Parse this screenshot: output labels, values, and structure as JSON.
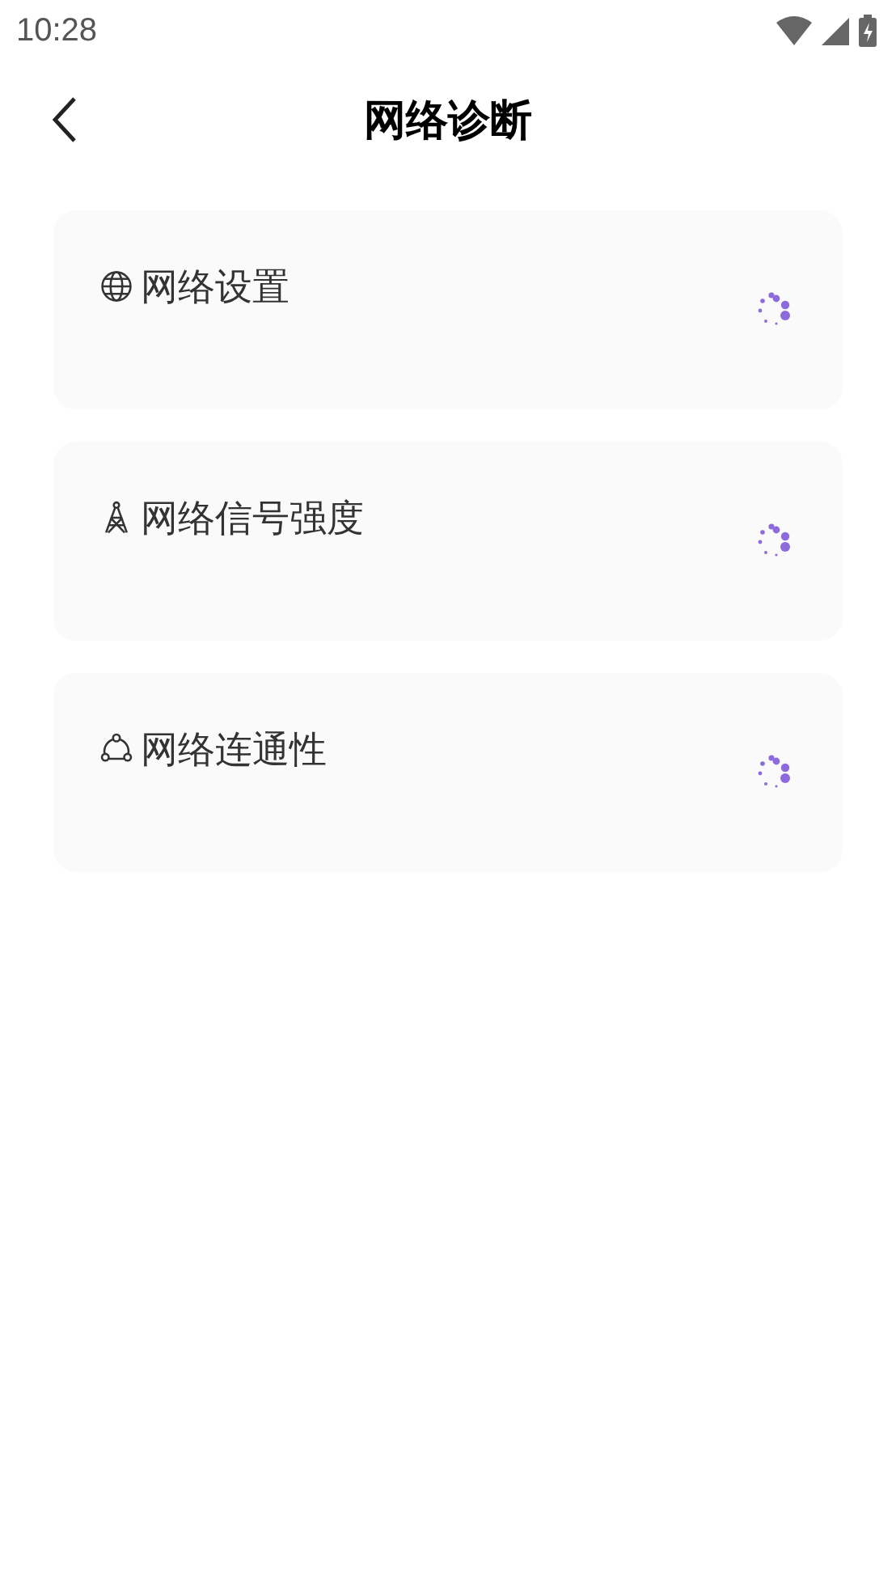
{
  "status_bar": {
    "time": "10:28"
  },
  "header": {
    "title": "网络诊断"
  },
  "items": [
    {
      "label": "网络设置",
      "kind": "globe",
      "loading": true
    },
    {
      "label": "网络信号强度",
      "kind": "tower",
      "loading": true
    },
    {
      "label": "网络连通性",
      "kind": "nodes",
      "loading": true
    }
  ]
}
